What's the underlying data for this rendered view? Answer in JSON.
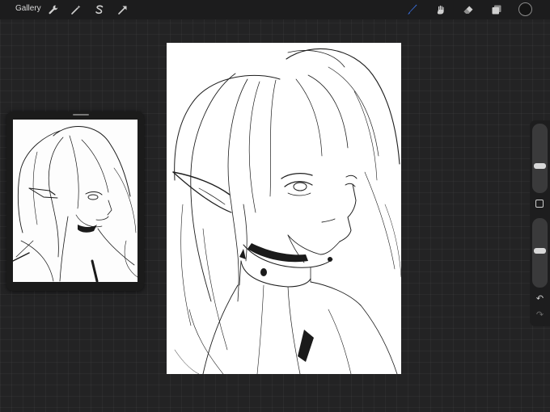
{
  "topbar": {
    "gallery_label": "Gallery",
    "left_tools": [
      "wrench-icon",
      "magic-wand-icon",
      "selection-icon",
      "transform-icon"
    ],
    "right_tools": [
      "brush-icon",
      "smudge-icon",
      "eraser-icon",
      "layers-icon"
    ],
    "active_tool": "brush-icon",
    "active_color": "#3b74e8",
    "current_color": "#141414"
  },
  "sidebar": {
    "brush_size_level": 0.32,
    "opacity_level": 0.5,
    "undo_icon": "↶",
    "redo_icon": "↷"
  }
}
